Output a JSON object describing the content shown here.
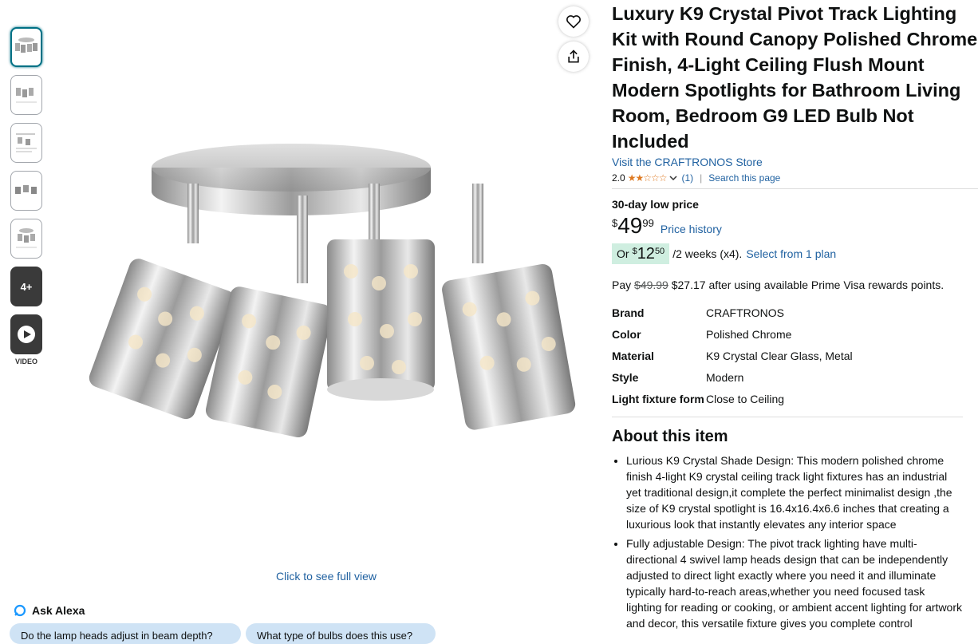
{
  "thumbnails": {
    "more_label": "4+",
    "video_label": "VIDEO"
  },
  "gallery": {
    "full_view_text": "Click to see full view"
  },
  "alexa": {
    "label": "Ask Alexa",
    "chips": [
      "Do the lamp heads adjust in beam depth?",
      "What type of bulbs does this use?"
    ]
  },
  "product": {
    "title": "Luxury K9 Crystal Pivot Track Lighting Kit with Round Canopy Polished Chrome Finish, 4-Light Ceiling Flush Mount Modern Spotlights for Bathroom Living Room, Bedroom G9 LED Bulb Not Included",
    "store_link": "Visit the CRAFTRONOS Store",
    "rating": "2.0",
    "rating_count": "(1)",
    "search_page": "Search this page",
    "low_price_label": "30-day low price",
    "price_symbol": "$",
    "price_whole": "49",
    "price_fraction": "99",
    "price_history": "Price history",
    "plan_or": "Or",
    "plan_symbol": "$",
    "plan_whole": "12",
    "plan_fraction": "50",
    "plan_terms": "/2 weeks (x4).",
    "plan_link": "Select from 1 plan",
    "pay_prefix": "Pay",
    "pay_old": "$49.99",
    "pay_new": "$27.17",
    "pay_suffix": "after using available Prime Visa rewards points."
  },
  "attributes": [
    {
      "key": "Brand",
      "value": "CRAFTRONOS"
    },
    {
      "key": "Color",
      "value": "Polished Chrome"
    },
    {
      "key": "Material",
      "value": "K9 Crystal Clear Glass, Metal"
    },
    {
      "key": "Style",
      "value": "Modern"
    },
    {
      "key": "Light fixture form",
      "value": "Close to Ceiling"
    }
  ],
  "about": {
    "heading": "About this item",
    "bullets": [
      "Lurious K9 Crystal Shade Design: This modern polished chrome finish 4-light K9 crystal ceiling track light fixtures has an industrial yet traditional design,it complete the perfect minimalist design ,the size of K9 crystal spotlight is 16.4x16.4x6.6 inches that creating a luxurious look that instantly elevates any interior space",
      "Fully adjustable Design: The pivot track lighting have multi-directional 4 swivel lamp heads design that can be independently adjusted to direct light exactly where you need it and illuminate typically hard-to-reach areas,whether you need focused task lighting for reading or cooking, or ambient accent lighting for artwork and decor, this versatile fixture gives you complete control"
    ]
  },
  "colors": {
    "link": "#2162a1",
    "star": "#de7921",
    "plan_badge": "#cfeee0"
  }
}
